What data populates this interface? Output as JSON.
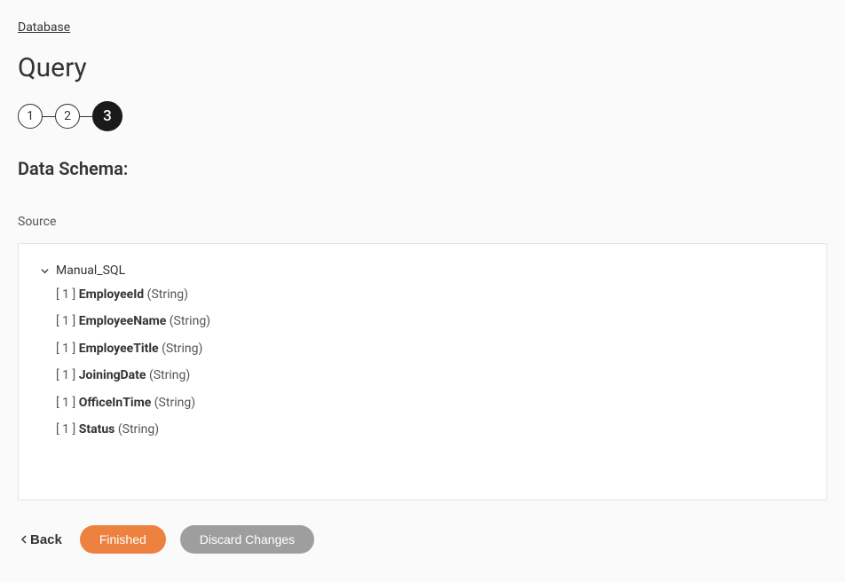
{
  "breadcrumb": "Database",
  "page_title": "Query",
  "stepper": {
    "steps": [
      "1",
      "2",
      "3"
    ],
    "active_index": 2
  },
  "section_heading": "Data Schema:",
  "source_label": "Source",
  "schema": {
    "root_name": "Manual_SQL",
    "fields": [
      {
        "prefix": "[ 1 ]",
        "name": "EmployeeId",
        "type": "(String)"
      },
      {
        "prefix": "[ 1 ]",
        "name": "EmployeeName",
        "type": "(String)"
      },
      {
        "prefix": "[ 1 ]",
        "name": "EmployeeTitle",
        "type": "(String)"
      },
      {
        "prefix": "[ 1 ]",
        "name": "JoiningDate",
        "type": "(String)"
      },
      {
        "prefix": "[ 1 ]",
        "name": "OfficeInTime",
        "type": "(String)"
      },
      {
        "prefix": "[ 1 ]",
        "name": "Status",
        "type": "(String)"
      }
    ]
  },
  "footer": {
    "back_label": "Back",
    "finished_label": "Finished",
    "discard_label": "Discard Changes"
  }
}
